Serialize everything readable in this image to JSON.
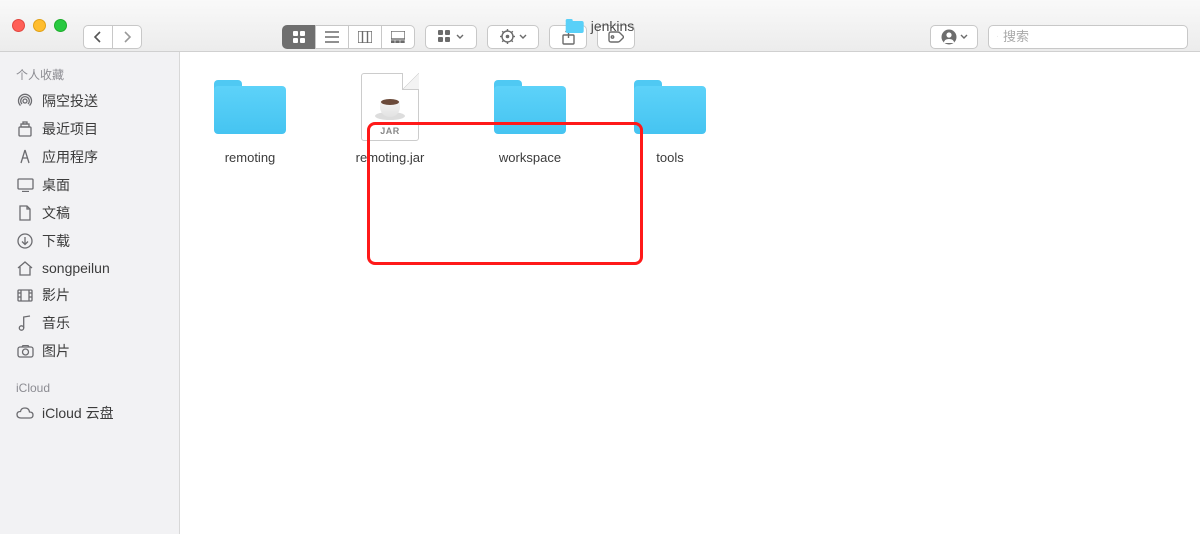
{
  "window": {
    "title": "jenkins"
  },
  "toolbar": {
    "search_placeholder": "搜索"
  },
  "sidebar": {
    "favorites_title": "个人收藏",
    "favorites": [
      {
        "label": "隔空投送",
        "icon": "airdrop"
      },
      {
        "label": "最近项目",
        "icon": "recent"
      },
      {
        "label": "应用程序",
        "icon": "apps"
      },
      {
        "label": "桌面",
        "icon": "desktop"
      },
      {
        "label": "文稿",
        "icon": "documents"
      },
      {
        "label": "下载",
        "icon": "downloads"
      },
      {
        "label": "songpeilun",
        "icon": "home"
      },
      {
        "label": "影片",
        "icon": "movies"
      },
      {
        "label": "音乐",
        "icon": "music"
      },
      {
        "label": "图片",
        "icon": "pictures"
      }
    ],
    "icloud_title": "iCloud",
    "icloud": [
      {
        "label": "iCloud 云盘",
        "icon": "cloud"
      }
    ]
  },
  "files": [
    {
      "name": "remoting",
      "type": "folder"
    },
    {
      "name": "remoting.jar",
      "type": "jar",
      "badge": "JAR"
    },
    {
      "name": "workspace",
      "type": "folder"
    },
    {
      "name": "tools",
      "type": "folder"
    }
  ]
}
